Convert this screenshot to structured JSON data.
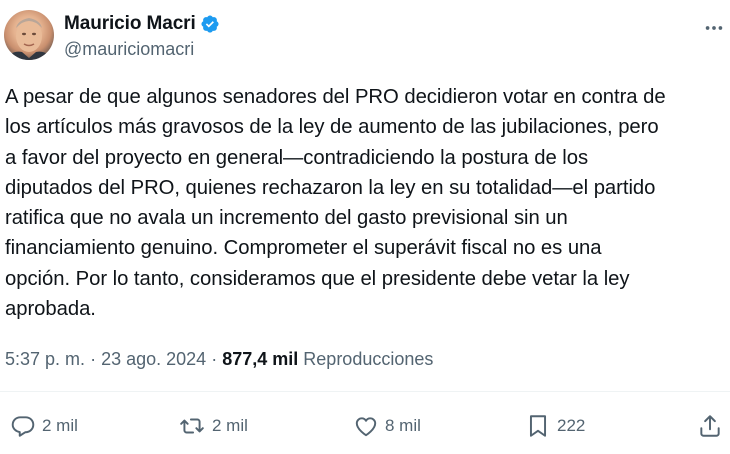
{
  "author": {
    "display_name": "Mauricio Macri",
    "handle": "@mauriciomacri",
    "verified": true
  },
  "tweet": {
    "text": "A pesar de que algunos senadores del PRO decidieron votar en contra de\nlos artículos más gravosos de la ley de aumento de las jubilaciones, pero\na favor del proyecto en general—contradiciendo la postura de los\ndiputados del PRO, quienes rechazaron la ley en su totalidad—el partido\nratifica que no avala un incremento del gasto previsional sin un\nfinanciamiento genuino. Comprometer el superávit fiscal no es una\nopción. Por lo tanto, consideramos que el presidente debe vetar la ley\naprobada.",
    "time": "5:37 p. m.",
    "separator": "·",
    "date": "23 ago. 2024",
    "views_count": "877,4 mil",
    "views_label": "Reproducciones"
  },
  "actions": {
    "replies": "2 mil",
    "reposts": "2 mil",
    "likes": "8 mil",
    "bookmarks": "222"
  },
  "colors": {
    "verified_blue": "#1d9bf0",
    "secondary_text": "#536471",
    "primary_text": "#0f1419"
  },
  "icons": [
    "verified-badge-icon",
    "more-icon",
    "reply-icon",
    "repost-icon",
    "like-icon",
    "bookmark-icon",
    "share-icon"
  ]
}
